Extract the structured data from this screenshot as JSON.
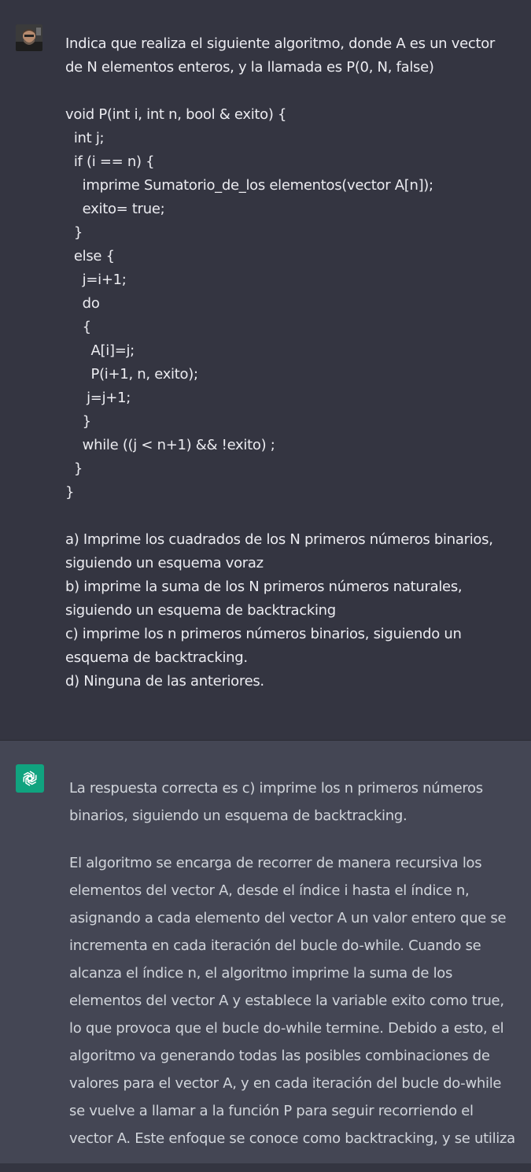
{
  "user_message": {
    "lines": [
      "Indica que realiza el siguiente algoritmo, donde A es un vector",
      "de N elementos enteros, y la llamada es P(0, N, false)",
      "",
      "void P(int i, int n, bool & exito) {",
      "  int j;",
      "  if (i == n) {",
      "    imprime Sumatorio_de_los elementos(vector A[n]);",
      "    exito= true;",
      "  }",
      "  else {",
      "    j=i+1;",
      "    do",
      "    {",
      "      A[i]=j;",
      "      P(i+1, n, exito);",
      "     j=j+1;",
      "    }",
      "    while ((j < n+1) && !exito) ;",
      "  }",
      "}",
      "",
      "a) Imprime los cuadrados de los N primeros números binarios,",
      "siguiendo un esquema voraz",
      "b) imprime la suma de los N primeros números naturales,",
      "siguiendo un esquema de backtracking",
      "c) imprime los n primeros números binarios, siguiendo un",
      "esquema de backtracking.",
      "d) Ninguna de las anteriores."
    ]
  },
  "assistant_message": {
    "paragraphs": [
      "La respuesta correcta es c) imprime los n primeros números binarios, siguiendo un esquema de backtracking.",
      "El algoritmo se encarga de recorrer de manera recursiva los elementos del vector A, desde el índice i hasta el índice n, asignando a cada elemento del vector A un valor entero que se incrementa en cada iteración del bucle do-while. Cuando se alcanza el índice n, el algoritmo imprime la suma de los elementos del vector A y establece la variable exito como true, lo que provoca que el bucle do-while termine. Debido a esto, el algoritmo va generando todas las posibles combinaciones de valores para el vector A, y en cada iteración del bucle do-while se vuelve a llamar a la función P para seguir recorriendo el vector A. Este enfoque se conoce como backtracking, y se utiliza"
    ]
  },
  "colors": {
    "user_bg": "#343541",
    "assistant_bg": "#444654",
    "gpt_icon_bg": "#10a37f"
  },
  "icons": {
    "user": "user-avatar-photo",
    "assistant": "openai-logo-icon"
  }
}
